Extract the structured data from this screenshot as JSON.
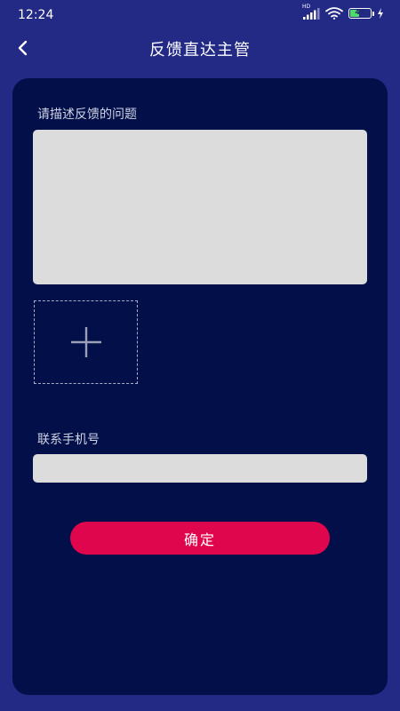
{
  "status_bar": {
    "time": "12:24",
    "network_label": "HD",
    "battery_level": "41",
    "battery_fraction": 0.41,
    "icons": [
      "signal-icon",
      "wifi-icon",
      "battery-icon",
      "charging-bolt-icon"
    ]
  },
  "nav": {
    "title": "反馈直达主管",
    "back_icon": "chevron-left-icon"
  },
  "form": {
    "problem_label": "请描述反馈的问题",
    "problem_value": "",
    "problem_placeholder": "",
    "upload_icon": "plus-icon",
    "phone_label": "联系手机号",
    "phone_value": "",
    "phone_placeholder": "",
    "confirm_label": "确定"
  },
  "colors": {
    "background": "#232a86",
    "card": "#020f48",
    "input": "#dcdcdc",
    "accent": "#e0064d",
    "battery": "#4ddc6c"
  }
}
